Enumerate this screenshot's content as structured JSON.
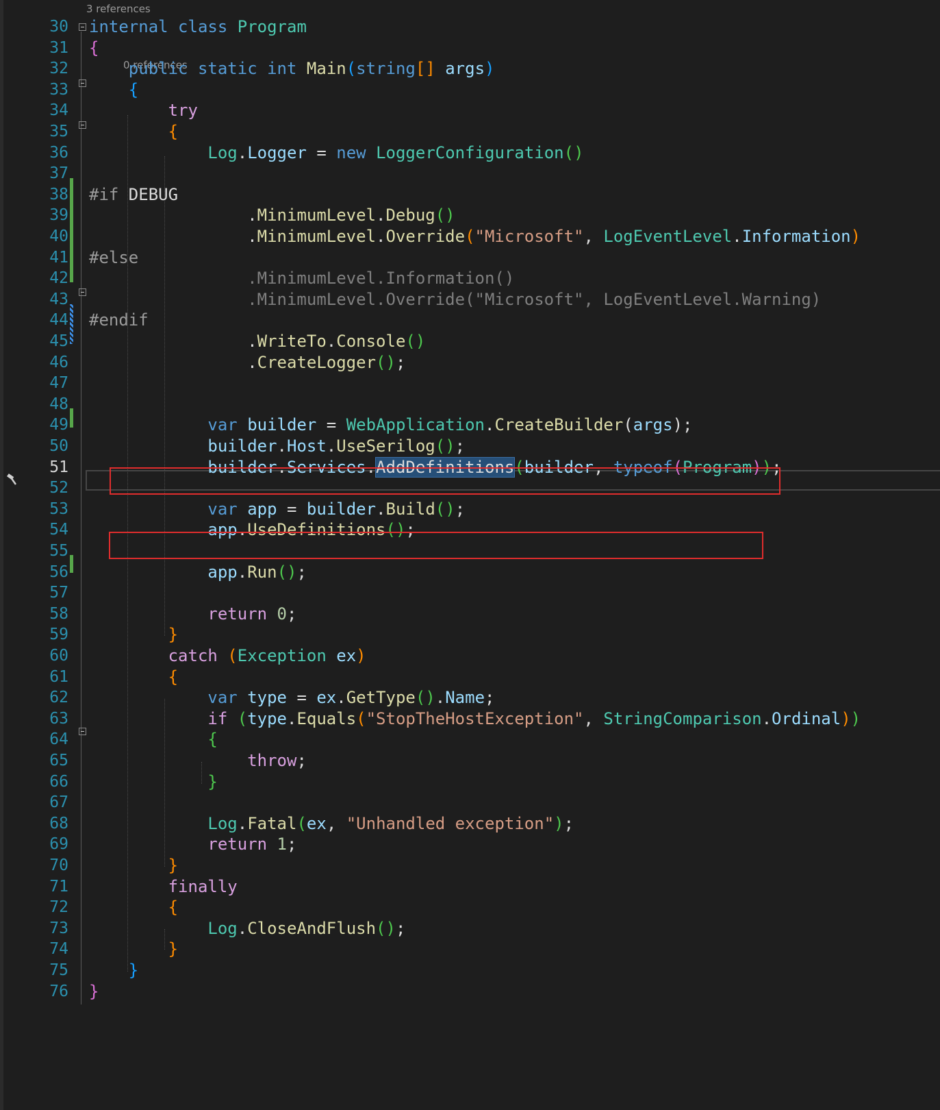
{
  "editor": {
    "codelens": [
      "3 references",
      "0 references"
    ],
    "lines": [
      {
        "n": "30",
        "tokens": [
          [
            "kw",
            "internal"
          ],
          [
            "tx",
            " "
          ],
          [
            "kw",
            "class"
          ],
          [
            "tx",
            " "
          ],
          [
            "ty",
            "Program"
          ]
        ]
      },
      {
        "n": "31",
        "tokens": [
          [
            "b1",
            "{"
          ]
        ]
      },
      {
        "n": "32",
        "tokens": [
          [
            "tx",
            "    "
          ],
          [
            "kw",
            "public"
          ],
          [
            "tx",
            " "
          ],
          [
            "kw",
            "static"
          ],
          [
            "tx",
            " "
          ],
          [
            "kw",
            "int"
          ],
          [
            "tx",
            " "
          ],
          [
            "fn",
            "Main"
          ],
          [
            "b2",
            "("
          ],
          [
            "kw",
            "string"
          ],
          [
            "b4",
            "[]"
          ],
          [
            "tx",
            " "
          ],
          [
            "pa",
            "args"
          ],
          [
            "b2",
            ")"
          ]
        ]
      },
      {
        "n": "33",
        "tokens": [
          [
            "tx",
            "    "
          ],
          [
            "b2",
            "{"
          ]
        ]
      },
      {
        "n": "34",
        "tokens": [
          [
            "tx",
            "        "
          ],
          [
            "ct",
            "try"
          ]
        ]
      },
      {
        "n": "35",
        "tokens": [
          [
            "tx",
            "        "
          ],
          [
            "b4",
            "{"
          ]
        ]
      },
      {
        "n": "36",
        "tokens": [
          [
            "tx",
            "            "
          ],
          [
            "ty",
            "Log"
          ],
          [
            "tx",
            "."
          ],
          [
            "pa",
            "Logger"
          ],
          [
            "tx",
            " = "
          ],
          [
            "kw",
            "new"
          ],
          [
            "tx",
            " "
          ],
          [
            "ty",
            "LoggerConfiguration"
          ],
          [
            "b5",
            "()"
          ]
        ]
      },
      {
        "n": "37",
        "tokens": []
      },
      {
        "n": "38",
        "tokens": [
          [
            "pp",
            "#if"
          ],
          [
            "tx",
            " DEBUG"
          ]
        ]
      },
      {
        "n": "39",
        "tokens": [
          [
            "tx",
            "                ."
          ],
          [
            "fn",
            "MinimumLevel"
          ],
          [
            "tx",
            "."
          ],
          [
            "fn",
            "Debug"
          ],
          [
            "b5",
            "()"
          ]
        ]
      },
      {
        "n": "40",
        "tokens": [
          [
            "tx",
            "                ."
          ],
          [
            "fn",
            "MinimumLevel"
          ],
          [
            "tx",
            "."
          ],
          [
            "fn",
            "Override"
          ],
          [
            "b4",
            "("
          ],
          [
            "st",
            "\"Microsoft\""
          ],
          [
            "tx",
            ", "
          ],
          [
            "ty",
            "LogEventLevel"
          ],
          [
            "tx",
            "."
          ],
          [
            "pa",
            "Information"
          ],
          [
            "b4",
            ")"
          ]
        ]
      },
      {
        "n": "41",
        "tokens": [
          [
            "pp",
            "#else"
          ]
        ]
      },
      {
        "n": "42",
        "tokens": [
          [
            "in",
            "                .MinimumLevel.Information()"
          ]
        ]
      },
      {
        "n": "43",
        "tokens": [
          [
            "in",
            "                .MinimumLevel.Override(\"Microsoft\", LogEventLevel.Warning)"
          ]
        ]
      },
      {
        "n": "44",
        "tokens": [
          [
            "pp",
            "#endif"
          ]
        ]
      },
      {
        "n": "45",
        "tokens": [
          [
            "tx",
            "                ."
          ],
          [
            "fn",
            "WriteTo"
          ],
          [
            "tx",
            "."
          ],
          [
            "fn",
            "Console"
          ],
          [
            "b5",
            "()"
          ]
        ]
      },
      {
        "n": "46",
        "tokens": [
          [
            "tx",
            "                ."
          ],
          [
            "fn",
            "CreateLogger"
          ],
          [
            "b5",
            "()"
          ],
          [
            "tx",
            ";"
          ]
        ]
      },
      {
        "n": "47",
        "tokens": []
      },
      {
        "n": "48",
        "tokens": []
      },
      {
        "n": "49",
        "tokens": [
          [
            "tx",
            "            "
          ],
          [
            "kw",
            "var"
          ],
          [
            "tx",
            " "
          ],
          [
            "pa",
            "builder"
          ],
          [
            "tx",
            " = "
          ],
          [
            "ty",
            "WebApplication"
          ],
          [
            "tx",
            "."
          ],
          [
            "fn",
            "CreateBuilder"
          ],
          [
            "tx",
            "("
          ],
          [
            "pa",
            "args"
          ],
          [
            "tx",
            ");"
          ]
        ]
      },
      {
        "n": "50",
        "tokens": [
          [
            "tx",
            "            "
          ],
          [
            "pa",
            "builder"
          ],
          [
            "tx",
            "."
          ],
          [
            "pa",
            "Host"
          ],
          [
            "tx",
            "."
          ],
          [
            "fn",
            "UseSerilog"
          ],
          [
            "b5",
            "()"
          ],
          [
            "tx",
            ";"
          ]
        ]
      },
      {
        "n": "51",
        "tokens": [
          [
            "tx",
            "            "
          ],
          [
            "pa",
            "builder"
          ],
          [
            "tx",
            "."
          ],
          [
            "pa",
            "Services"
          ],
          [
            "tx",
            "."
          ],
          [
            "sel",
            "AddDefinitions"
          ],
          [
            "b5",
            "("
          ],
          [
            "pa",
            "builder"
          ],
          [
            "tx",
            ", "
          ],
          [
            "kw",
            "typeof"
          ],
          [
            "b1",
            "("
          ],
          [
            "ty",
            "Program"
          ],
          [
            "b1",
            ")"
          ],
          [
            "b5",
            ")"
          ],
          [
            "tx",
            ";"
          ]
        ]
      },
      {
        "n": "52",
        "tokens": []
      },
      {
        "n": "53",
        "tokens": [
          [
            "tx",
            "            "
          ],
          [
            "kw",
            "var"
          ],
          [
            "tx",
            " "
          ],
          [
            "pa",
            "app"
          ],
          [
            "tx",
            " = "
          ],
          [
            "pa",
            "builder"
          ],
          [
            "tx",
            "."
          ],
          [
            "fn",
            "Build"
          ],
          [
            "b5",
            "()"
          ],
          [
            "tx",
            ";"
          ]
        ]
      },
      {
        "n": "54",
        "tokens": [
          [
            "tx",
            "            "
          ],
          [
            "pa",
            "app"
          ],
          [
            "tx",
            "."
          ],
          [
            "fn",
            "UseDefinitions"
          ],
          [
            "b5",
            "()"
          ],
          [
            "tx",
            ";"
          ]
        ]
      },
      {
        "n": "55",
        "tokens": []
      },
      {
        "n": "56",
        "tokens": [
          [
            "tx",
            "            "
          ],
          [
            "pa",
            "app"
          ],
          [
            "tx",
            "."
          ],
          [
            "fn",
            "Run"
          ],
          [
            "b5",
            "()"
          ],
          [
            "tx",
            ";"
          ]
        ]
      },
      {
        "n": "57",
        "tokens": []
      },
      {
        "n": "58",
        "tokens": [
          [
            "tx",
            "            "
          ],
          [
            "ct",
            "return"
          ],
          [
            "tx",
            " "
          ],
          [
            "nu",
            "0"
          ],
          [
            "tx",
            ";"
          ]
        ]
      },
      {
        "n": "59",
        "tokens": [
          [
            "tx",
            "        "
          ],
          [
            "b4",
            "}"
          ]
        ]
      },
      {
        "n": "60",
        "tokens": [
          [
            "tx",
            "        "
          ],
          [
            "ct",
            "catch"
          ],
          [
            "tx",
            " "
          ],
          [
            "b4",
            "("
          ],
          [
            "ty",
            "Exception"
          ],
          [
            "tx",
            " "
          ],
          [
            "pa",
            "ex"
          ],
          [
            "b4",
            ")"
          ]
        ]
      },
      {
        "n": "61",
        "tokens": [
          [
            "tx",
            "        "
          ],
          [
            "b4",
            "{"
          ]
        ]
      },
      {
        "n": "62",
        "tokens": [
          [
            "tx",
            "            "
          ],
          [
            "kw",
            "var"
          ],
          [
            "tx",
            " "
          ],
          [
            "pa",
            "type"
          ],
          [
            "tx",
            " = "
          ],
          [
            "pa",
            "ex"
          ],
          [
            "tx",
            "."
          ],
          [
            "fn",
            "GetType"
          ],
          [
            "b5",
            "()"
          ],
          [
            "tx",
            "."
          ],
          [
            "pa",
            "Name"
          ],
          [
            "tx",
            ";"
          ]
        ]
      },
      {
        "n": "63",
        "tokens": [
          [
            "tx",
            "            "
          ],
          [
            "ct",
            "if"
          ],
          [
            "tx",
            " "
          ],
          [
            "b5",
            "("
          ],
          [
            "pa",
            "type"
          ],
          [
            "tx",
            "."
          ],
          [
            "fn",
            "Equals"
          ],
          [
            "b4",
            "("
          ],
          [
            "st",
            "\"StopTheHostException\""
          ],
          [
            "tx",
            ", "
          ],
          [
            "ty",
            "StringComparison"
          ],
          [
            "tx",
            "."
          ],
          [
            "pa",
            "Ordinal"
          ],
          [
            "b4",
            ")"
          ],
          [
            "b5",
            ")"
          ]
        ]
      },
      {
        "n": "64",
        "tokens": [
          [
            "tx",
            "            "
          ],
          [
            "b5",
            "{"
          ]
        ]
      },
      {
        "n": "65",
        "tokens": [
          [
            "tx",
            "                "
          ],
          [
            "ct",
            "throw"
          ],
          [
            "tx",
            ";"
          ]
        ]
      },
      {
        "n": "66",
        "tokens": [
          [
            "tx",
            "            "
          ],
          [
            "b5",
            "}"
          ]
        ]
      },
      {
        "n": "67",
        "tokens": []
      },
      {
        "n": "68",
        "tokens": [
          [
            "tx",
            "            "
          ],
          [
            "ty",
            "Log"
          ],
          [
            "tx",
            "."
          ],
          [
            "fn",
            "Fatal"
          ],
          [
            "b5",
            "("
          ],
          [
            "pa",
            "ex"
          ],
          [
            "tx",
            ", "
          ],
          [
            "st",
            "\"Unhandled exception\""
          ],
          [
            "b5",
            ")"
          ],
          [
            "tx",
            ";"
          ]
        ]
      },
      {
        "n": "69",
        "tokens": [
          [
            "tx",
            "            "
          ],
          [
            "ct",
            "return"
          ],
          [
            "tx",
            " "
          ],
          [
            "nu",
            "1"
          ],
          [
            "tx",
            ";"
          ]
        ]
      },
      {
        "n": "70",
        "tokens": [
          [
            "tx",
            "        "
          ],
          [
            "b4",
            "}"
          ]
        ]
      },
      {
        "n": "71",
        "tokens": [
          [
            "tx",
            "        "
          ],
          [
            "ct",
            "finally"
          ]
        ]
      },
      {
        "n": "72",
        "tokens": [
          [
            "tx",
            "        "
          ],
          [
            "b4",
            "{"
          ]
        ]
      },
      {
        "n": "73",
        "tokens": [
          [
            "tx",
            "            "
          ],
          [
            "ty",
            "Log"
          ],
          [
            "tx",
            "."
          ],
          [
            "fn",
            "CloseAndFlush"
          ],
          [
            "b5",
            "()"
          ],
          [
            "tx",
            ";"
          ]
        ]
      },
      {
        "n": "74",
        "tokens": [
          [
            "tx",
            "        "
          ],
          [
            "b4",
            "}"
          ]
        ]
      },
      {
        "n": "75",
        "tokens": [
          [
            "tx",
            "    "
          ],
          [
            "b2",
            "}"
          ]
        ]
      },
      {
        "n": "76",
        "tokens": [
          [
            "b1",
            "}"
          ]
        ]
      }
    ],
    "current_line": "51",
    "colors": {
      "background": "#1e1e1e",
      "line_number": "#2b91af",
      "highlight_box": "#e02d2d",
      "change_bar": "#57a64a"
    },
    "icons": [
      "hammer-icon",
      "collapse-icon"
    ]
  }
}
